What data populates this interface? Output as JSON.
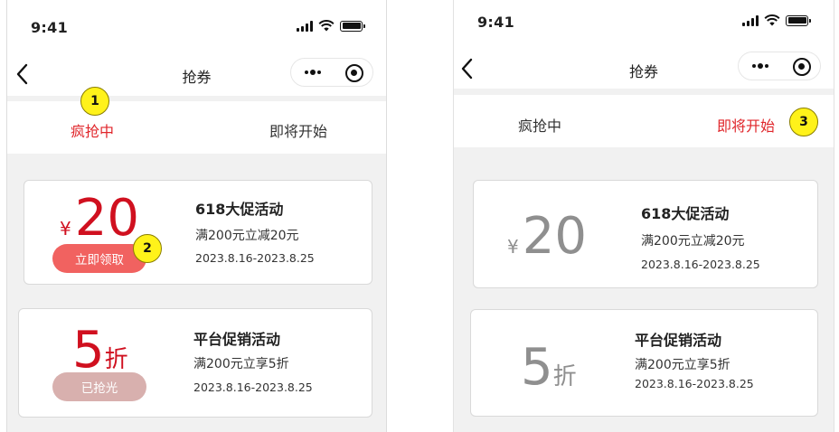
{
  "status_bar": {
    "time": "9:41"
  },
  "nav": {
    "title": "抢券"
  },
  "tabs": {
    "hot": "疯抢中",
    "upcoming": "即将开始"
  },
  "markers": [
    "1",
    "2",
    "3"
  ],
  "coupons": [
    {
      "currency": "¥",
      "value": "20",
      "unit": "",
      "title": "618大促活动",
      "desc": "满200元立减20元",
      "date": "2023.8.16-2023.8.25",
      "button": "立即领取"
    },
    {
      "currency": "",
      "value": "5",
      "unit": "折",
      "title": "平台促销活动",
      "desc": "满200元立享5折",
      "date": "2023.8.16-2023.8.25",
      "button": "已抢光"
    }
  ],
  "colors": {
    "active_tab": "#e0262b",
    "price_active": "#d0101f",
    "price_inactive": "#8f8f8f",
    "claim_button": "#f16260",
    "sold_out_button": "#d8b0ae",
    "marker": "#fff21a",
    "page_background": "#f1f1f1"
  },
  "icons": [
    "back-arrow-icon",
    "more-dots-icon",
    "mini-program-close-icon",
    "signal-icon",
    "wifi-icon",
    "battery-icon"
  ]
}
